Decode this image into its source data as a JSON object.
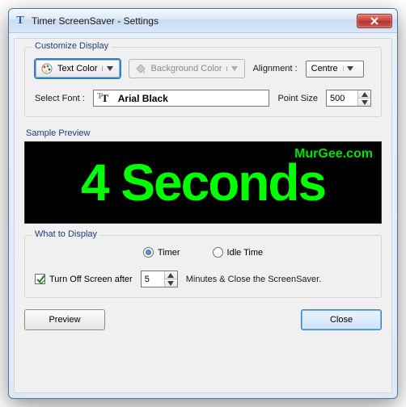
{
  "window": {
    "title": "Timer ScreenSaver - Settings"
  },
  "groups": {
    "customize": "Customize Display",
    "what": "What to Display"
  },
  "customize": {
    "textColorLabel": "Text Color",
    "bgColorLabel": "Background Color",
    "alignmentLabel": "Alignment :",
    "alignmentValue": "Centre",
    "selectFontLabel": "Select Font :",
    "fontName": "Arial Black",
    "pointSizeLabel": "Point Size",
    "pointSizeValue": "500"
  },
  "preview": {
    "label": "Sample Preview",
    "watermark": "MurGee.com",
    "text": "4 Seconds"
  },
  "what": {
    "timerLabel": "Timer",
    "idleLabel": "Idle Time",
    "selected": "timer",
    "turnOffLabel": "Turn Off Screen after",
    "turnOffChecked": true,
    "turnOffValue": "5",
    "turnOffSuffix": "Minutes & Close the ScreenSaver."
  },
  "buttons": {
    "preview": "Preview",
    "close": "Close"
  }
}
